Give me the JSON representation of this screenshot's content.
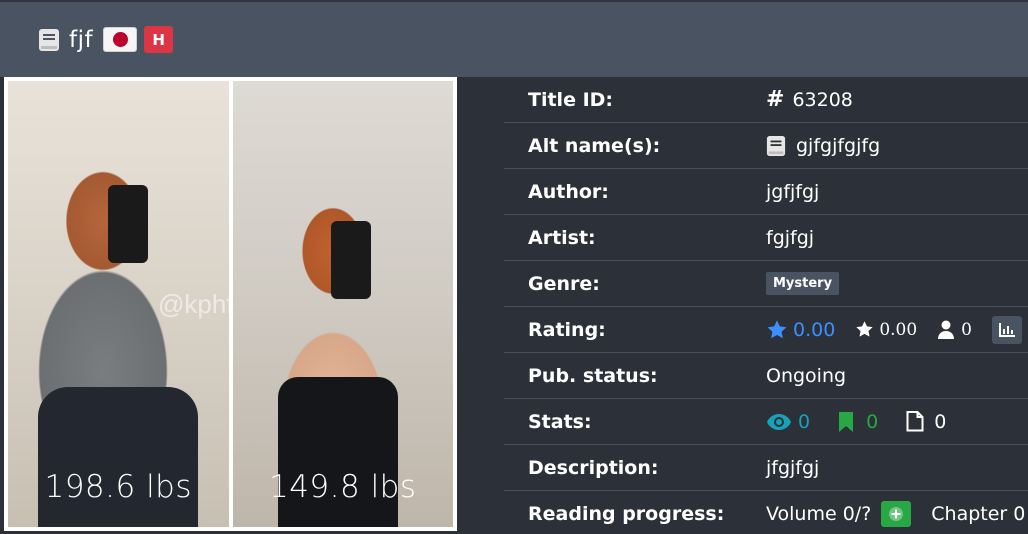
{
  "header": {
    "title": "fjf",
    "flag": "japan-flag",
    "badge": "H"
  },
  "cover": {
    "watermark": "@kphfit",
    "weight_before": "198.6 lbs",
    "weight_after": "149.8 lbs"
  },
  "info": {
    "title_id": {
      "label": "Title ID:",
      "value": "63208"
    },
    "alt_names": {
      "label": "Alt name(s):",
      "value": "gjfgjfgjfg"
    },
    "author": {
      "label": "Author:",
      "value": "jgfjfgj"
    },
    "artist": {
      "label": "Artist:",
      "value": "fgjfgj"
    },
    "genre": {
      "label": "Genre:",
      "value": "Mystery"
    },
    "rating": {
      "label": "Rating:",
      "bayesian": "0.00",
      "mean": "0.00",
      "users": "0"
    },
    "pub_status": {
      "label": "Pub. status:",
      "value": "Ongoing"
    },
    "stats": {
      "label": "Stats:",
      "views": "0",
      "follows": "0",
      "chapters": "0"
    },
    "description": {
      "label": "Description:",
      "value": "jfgjfgj"
    },
    "reading_progress": {
      "label": "Reading progress:",
      "volume": "Volume 0/?",
      "chapter": "Chapter 0"
    }
  },
  "colors": {
    "header_bg": "#4a5362",
    "page_bg": "#2c3038",
    "accent_blue": "#3b8fff",
    "accent_teal": "#17a2b8",
    "accent_green": "#28a745",
    "badge_red": "#dc3545"
  }
}
